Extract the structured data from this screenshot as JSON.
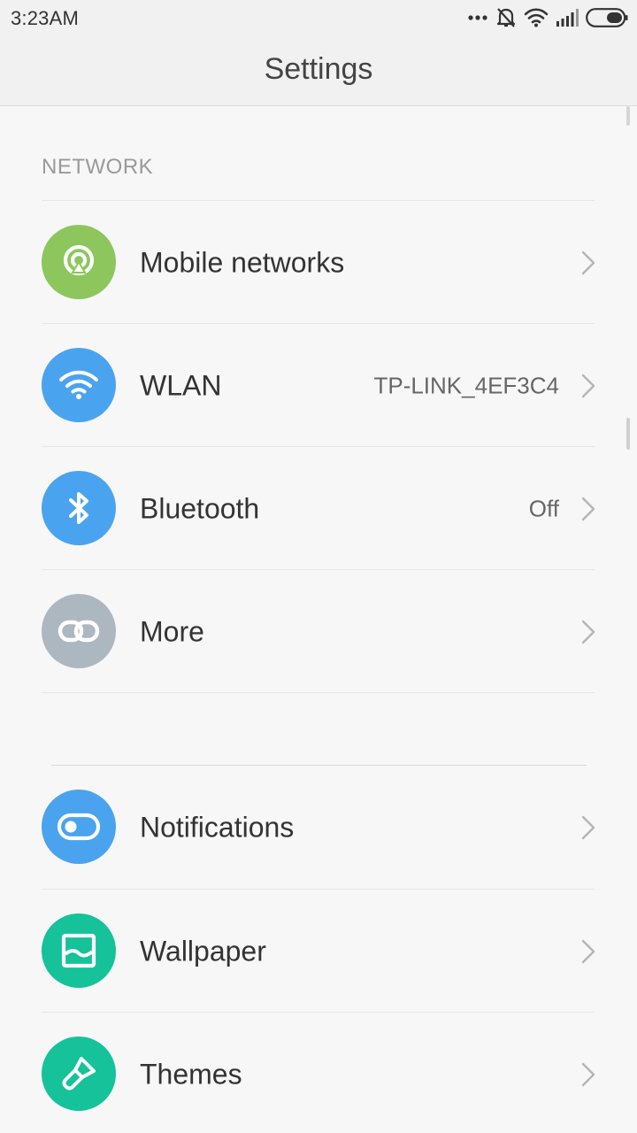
{
  "status_bar": {
    "time": "3:23AM",
    "icons": [
      "more-dots-icon",
      "alarm-off-icon",
      "wifi-icon",
      "signal-icon",
      "battery-icon"
    ]
  },
  "header": {
    "title": "Settings"
  },
  "network_section": {
    "title": "NETWORK",
    "items": [
      {
        "label": "Mobile networks",
        "value": "",
        "icon": "mobile-networks-icon",
        "color": "#8cc65c"
      },
      {
        "label": "WLAN",
        "value": "TP-LINK_4EF3C4",
        "icon": "wifi-icon",
        "color": "#4aa3ef"
      },
      {
        "label": "Bluetooth",
        "value": "Off",
        "icon": "bluetooth-icon",
        "color": "#4aa3ef"
      },
      {
        "label": "More",
        "value": "",
        "icon": "link-icon",
        "color": "#adb7bf"
      }
    ]
  },
  "personal_section": {
    "items": [
      {
        "label": "Notifications",
        "value": "",
        "icon": "toggle-icon",
        "color": "#4aa3ef"
      },
      {
        "label": "Wallpaper",
        "value": "",
        "icon": "wallpaper-icon",
        "color": "#15c29a"
      },
      {
        "label": "Themes",
        "value": "",
        "icon": "brush-icon",
        "color": "#15c29a"
      }
    ]
  }
}
